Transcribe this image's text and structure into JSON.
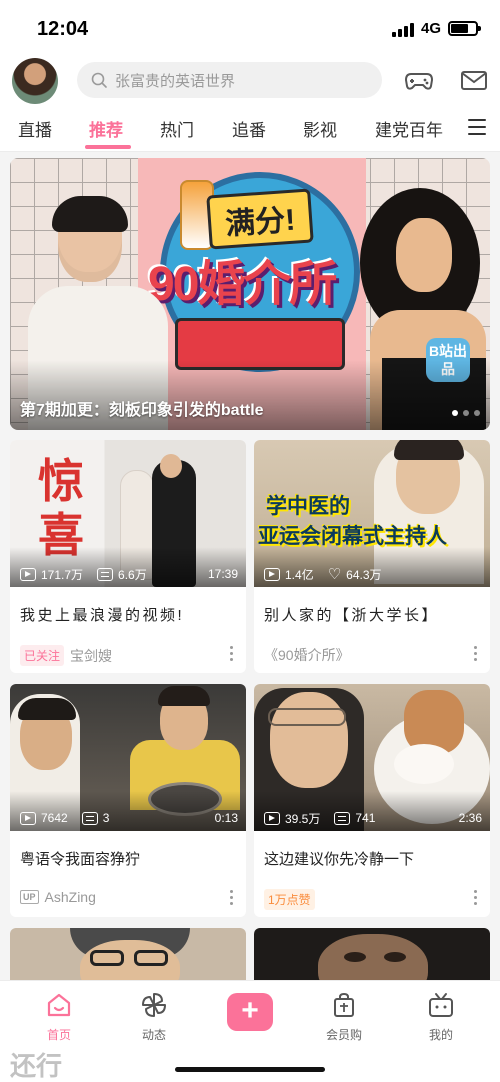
{
  "status_bar": {
    "time": "12:04",
    "network": "4G"
  },
  "header": {
    "search_placeholder": "张富贵的英语世界"
  },
  "tabs": [
    {
      "label": "直播"
    },
    {
      "label": "推荐"
    },
    {
      "label": "热门"
    },
    {
      "label": "追番"
    },
    {
      "label": "影视"
    },
    {
      "label": "建党百年"
    }
  ],
  "active_tab_index": 1,
  "banner": {
    "caption": "第7期加更：刻板印象引发的battle",
    "logo_top": "满分!",
    "logo_main": "90婚介所",
    "badge": "B站出品",
    "slide_count": 3,
    "active_slide": 1
  },
  "cards": [
    {
      "views": "171.7万",
      "danmaku": "6.6万",
      "duration": "17:39",
      "title": "我史上最浪漫的视频!",
      "tag": "已关注",
      "author": "宝剑嫂",
      "thumb_text": [
        "惊",
        "喜"
      ]
    },
    {
      "views": "1.4亿",
      "likes": "64.3万",
      "title": "别人家的【浙大学长】",
      "author": "《90婚介所》",
      "thumb_text": [
        "学中医的",
        "亚运会闭幕式主持人"
      ]
    },
    {
      "views": "7642",
      "danmaku": "3",
      "duration": "0:13",
      "title": "粤语令我面容狰狞",
      "author_badge": "UP",
      "author": "AshZing"
    },
    {
      "views": "39.5万",
      "danmaku": "741",
      "duration": "2:36",
      "title": "这边建议你先冷静一下",
      "tag": "1万点赞"
    }
  ],
  "bottom_nav": {
    "home": "首页",
    "dynamic": "动态",
    "publish": "+",
    "vip_shop": "会员购",
    "mine": "我的"
  },
  "watermark": "还行",
  "colors": {
    "accent": "#fb7299",
    "like_tag": "#fa8c3c"
  }
}
